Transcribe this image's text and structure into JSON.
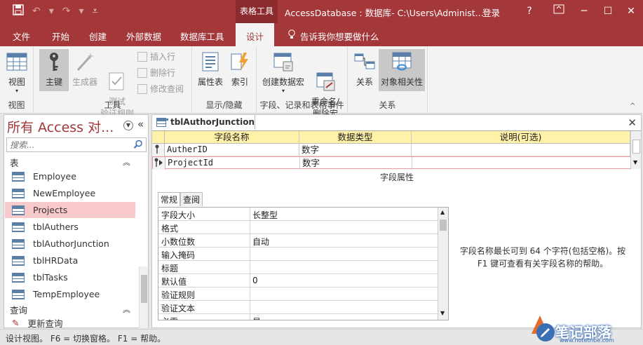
{
  "titlebar": {
    "context_tab": "表格工具",
    "window_title": "AccessDatabase : 数据库- C:\\Users\\Administ...",
    "login": "登录",
    "help": "?",
    "minimize": "─",
    "maximize": "☐",
    "close": "✕"
  },
  "tabs": [
    {
      "label": "文件"
    },
    {
      "label": "开始"
    },
    {
      "label": "创建"
    },
    {
      "label": "外部数据"
    },
    {
      "label": "数据库工具"
    },
    {
      "label": "设计"
    }
  ],
  "tellme": "告诉我你想要做什么",
  "ribbon": {
    "view": {
      "label": "视图",
      "group": "视图"
    },
    "tools": {
      "group": "工具",
      "primary_key": "主键",
      "builder": "生成器",
      "test_rules": "测试\n验证规则",
      "insert_rows": "插入行",
      "delete_rows": "删除行",
      "modify_lookups": "修改查阅"
    },
    "showhide": {
      "group": "显示/隐藏",
      "property_sheet": "属性表",
      "indexes": "索引"
    },
    "events": {
      "group": "字段、记录和表格事件",
      "create_macros": "创建数据宏",
      "rename_delete": "重命名/\n删除宏"
    },
    "relationships": {
      "group": "关系",
      "relations": "关系",
      "dependencies": "对象相关性"
    }
  },
  "nav": {
    "title": "所有 Access 对...",
    "search_placeholder": "搜索...",
    "section_tables": "表",
    "tables": [
      {
        "label": "Employee"
      },
      {
        "label": "NewEmployee"
      },
      {
        "label": "Projects"
      },
      {
        "label": "tblAuthers"
      },
      {
        "label": "tblAuthorJunction"
      },
      {
        "label": "tblHRData"
      },
      {
        "label": "tblTasks"
      },
      {
        "label": "TempEmployee"
      }
    ],
    "section_queries": "查询",
    "queries": [
      {
        "label": "更新查询"
      }
    ]
  },
  "document": {
    "tab_label": "tblAuthorJunction",
    "columns": [
      "字段名称",
      "数据类型",
      "说明(可选)"
    ],
    "rows": [
      {
        "name": "AutherID",
        "type": "数字",
        "desc": ""
      },
      {
        "name": "ProjectId",
        "type": "数字",
        "desc": ""
      }
    ],
    "field_properties_label": "字段属性",
    "prop_tabs": [
      "常规",
      "查阅"
    ],
    "properties": [
      {
        "k": "字段大小",
        "v": "长整型"
      },
      {
        "k": "格式",
        "v": ""
      },
      {
        "k": "小数位数",
        "v": "自动"
      },
      {
        "k": "输入掩码",
        "v": ""
      },
      {
        "k": "标题",
        "v": ""
      },
      {
        "k": "默认值",
        "v": "0"
      },
      {
        "k": "验证规则",
        "v": ""
      },
      {
        "k": "验证文本",
        "v": ""
      },
      {
        "k": "必需",
        "v": "是"
      }
    ],
    "help_text": "字段名称最长可到 64 个字符(包括空格)。按 F1 键可查看有关字段名称的帮助。"
  },
  "status": "设计视图。  F6 = 切换窗格。  F1 = 帮助。",
  "watermark": {
    "title": "笔记部落",
    "site": "www.notetribe.com"
  },
  "colors": {
    "brand": "#a4373a",
    "header_yellow": "#fff1a8",
    "selected_row": "#f8c9cb"
  }
}
